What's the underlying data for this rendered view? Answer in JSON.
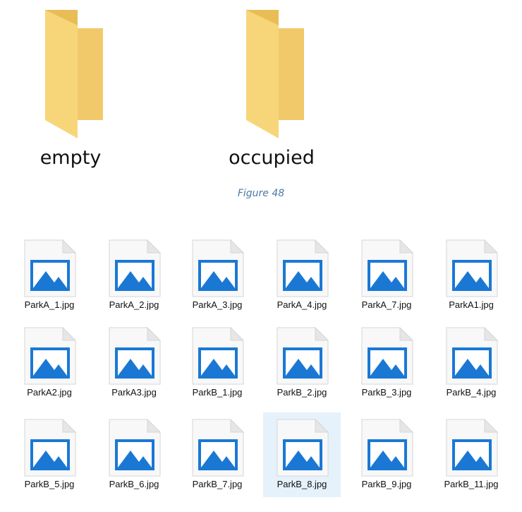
{
  "folders": [
    {
      "label": "empty",
      "icon": "folder-icon"
    },
    {
      "label": "occupied",
      "icon": "folder-icon"
    }
  ],
  "caption": "Figure 48",
  "files": [
    {
      "name": "ParkA_1.jpg",
      "icon": "image-file-icon"
    },
    {
      "name": "ParkA_2.jpg",
      "icon": "image-file-icon"
    },
    {
      "name": "ParkA_3.jpg",
      "icon": "image-file-icon"
    },
    {
      "name": "ParkA_4.jpg",
      "icon": "image-file-icon"
    },
    {
      "name": "ParkA_7.jpg",
      "icon": "image-file-icon"
    },
    {
      "name": "ParkA1.jpg",
      "icon": "image-file-icon"
    },
    {
      "name": "ParkA2.jpg",
      "icon": "image-file-icon"
    },
    {
      "name": "ParkA3.jpg",
      "icon": "image-file-icon"
    },
    {
      "name": "ParkB_1.jpg",
      "icon": "image-file-icon"
    },
    {
      "name": "ParkB_2.jpg",
      "icon": "image-file-icon"
    },
    {
      "name": "ParkB_3.jpg",
      "icon": "image-file-icon"
    },
    {
      "name": "ParkB_4.jpg",
      "icon": "image-file-icon"
    },
    {
      "name": "ParkB_5.jpg",
      "icon": "image-file-icon"
    },
    {
      "name": "ParkB_6.jpg",
      "icon": "image-file-icon"
    },
    {
      "name": "ParkB_7.jpg",
      "icon": "image-file-icon"
    },
    {
      "name": "ParkB_8.jpg",
      "icon": "image-file-icon",
      "selected": true
    },
    {
      "name": "ParkB_9.jpg",
      "icon": "image-file-icon"
    },
    {
      "name": "ParkB_11.jpg",
      "icon": "image-file-icon"
    }
  ],
  "colors": {
    "folder_front": "#f7d67a",
    "folder_back": "#e9bd55",
    "image_blue": "#1a78d4",
    "caption": "#4a7aa6",
    "selection": "#e5f1fb"
  }
}
